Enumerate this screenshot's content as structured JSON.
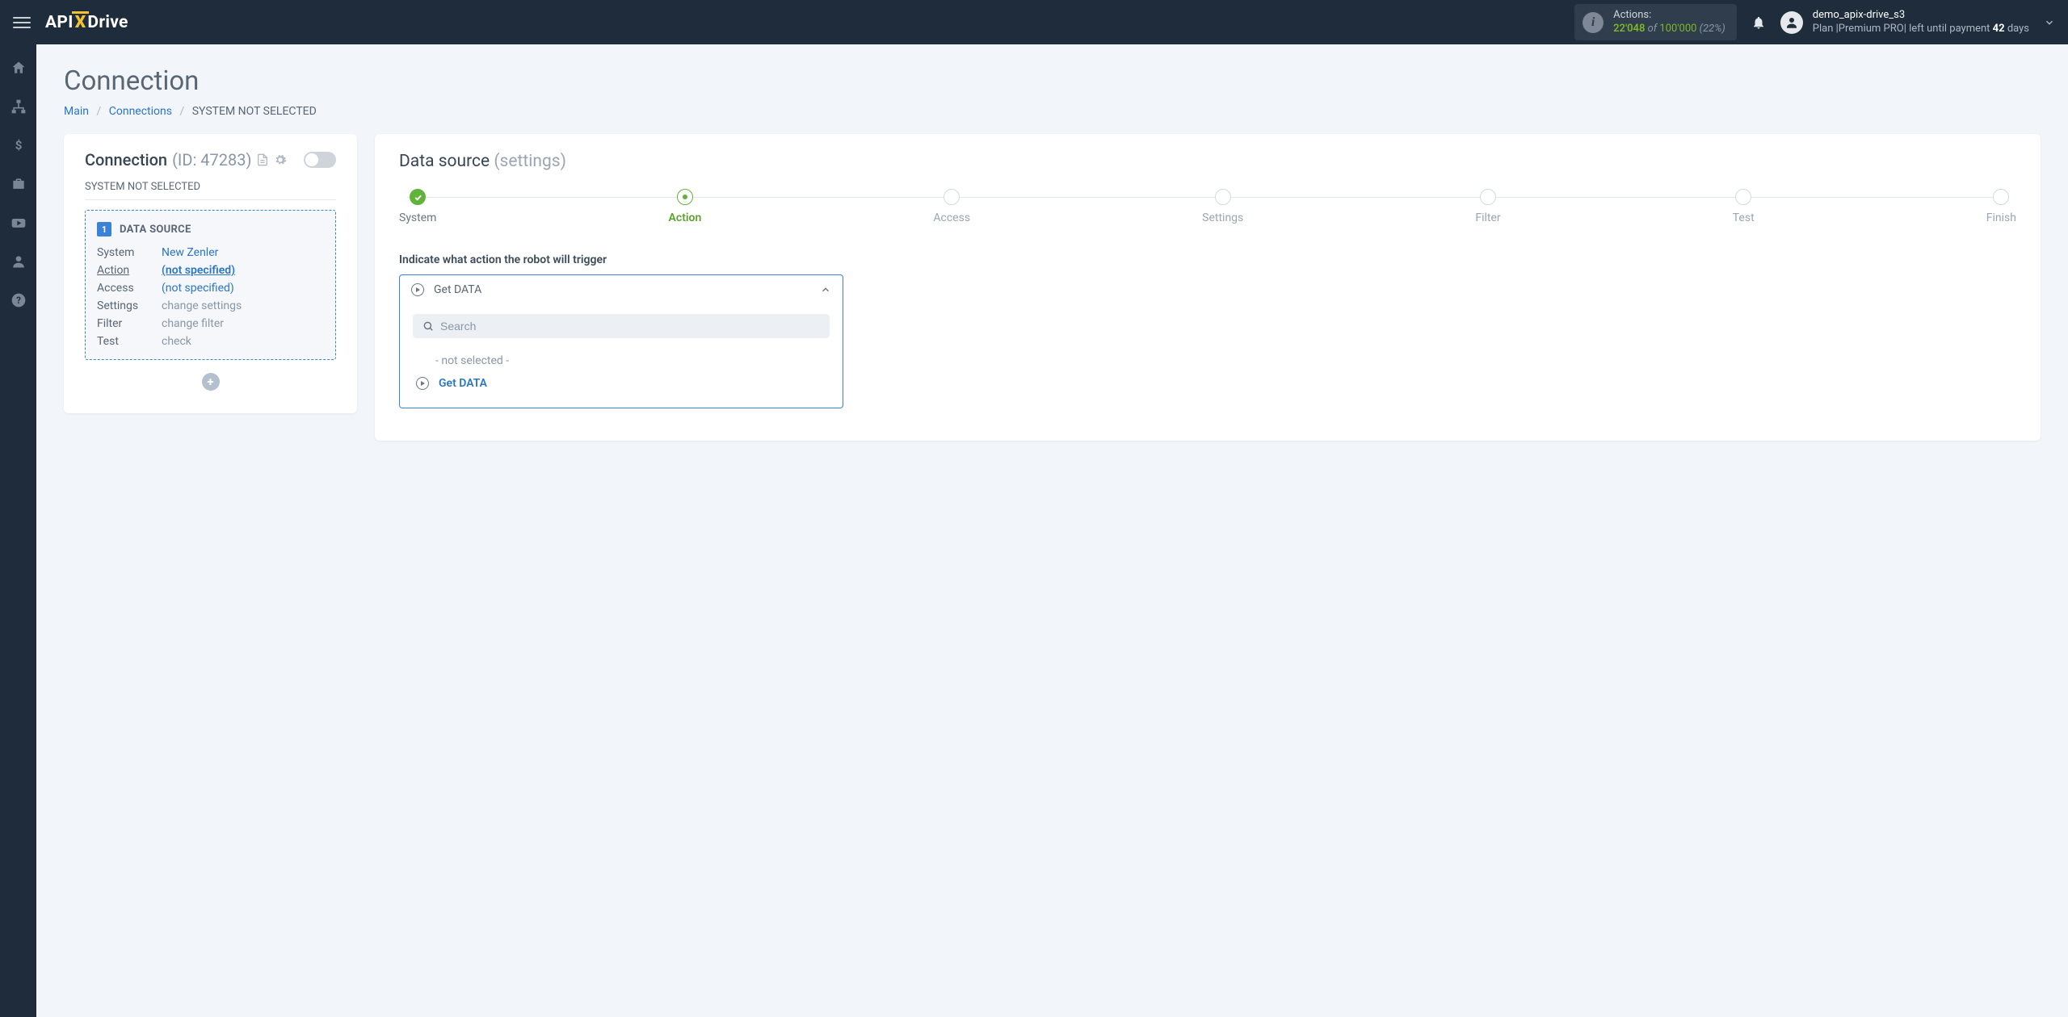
{
  "header": {
    "logo_prefix": "API",
    "logo_x": "X",
    "logo_suffix": "Drive",
    "actions_label": "Actions:",
    "actions_used": "22'048",
    "actions_of": " of ",
    "actions_total": "100'000",
    "actions_pct": " (22%)",
    "username": "demo_apix-drive_s3",
    "plan_prefix": "Plan |",
    "plan_name": "Premium PRO",
    "plan_mid": "| left until payment ",
    "plan_days": "42",
    "plan_suffix": " days"
  },
  "page": {
    "title": "Connection",
    "bc_main": "Main",
    "bc_connections": "Connections",
    "bc_current": "SYSTEM NOT SELECTED"
  },
  "left": {
    "heading": "Connection",
    "id_label": "(ID: 47283)",
    "subtitle": "SYSTEM NOT SELECTED",
    "badge_num": "1",
    "ds_title": "DATA SOURCE",
    "rows": {
      "system_k": "System",
      "system_v": "New Zenler",
      "action_k": "Action",
      "action_v": "(not specified)",
      "access_k": "Access",
      "access_v": "(not specified)",
      "settings_k": "Settings",
      "settings_v": "change settings",
      "filter_k": "Filter",
      "filter_v": "change filter",
      "test_k": "Test",
      "test_v": "check"
    }
  },
  "right": {
    "title_main": "Data source ",
    "title_sub": "(settings)",
    "steps": {
      "s1": "System",
      "s2": "Action",
      "s3": "Access",
      "s4": "Settings",
      "s5": "Filter",
      "s6": "Test",
      "s7": "Finish"
    },
    "field_label": "Indicate what action the robot will trigger",
    "dd_value": "Get DATA",
    "search_placeholder": "Search",
    "opt_none": "- not selected -",
    "opt_get": "Get DATA"
  }
}
